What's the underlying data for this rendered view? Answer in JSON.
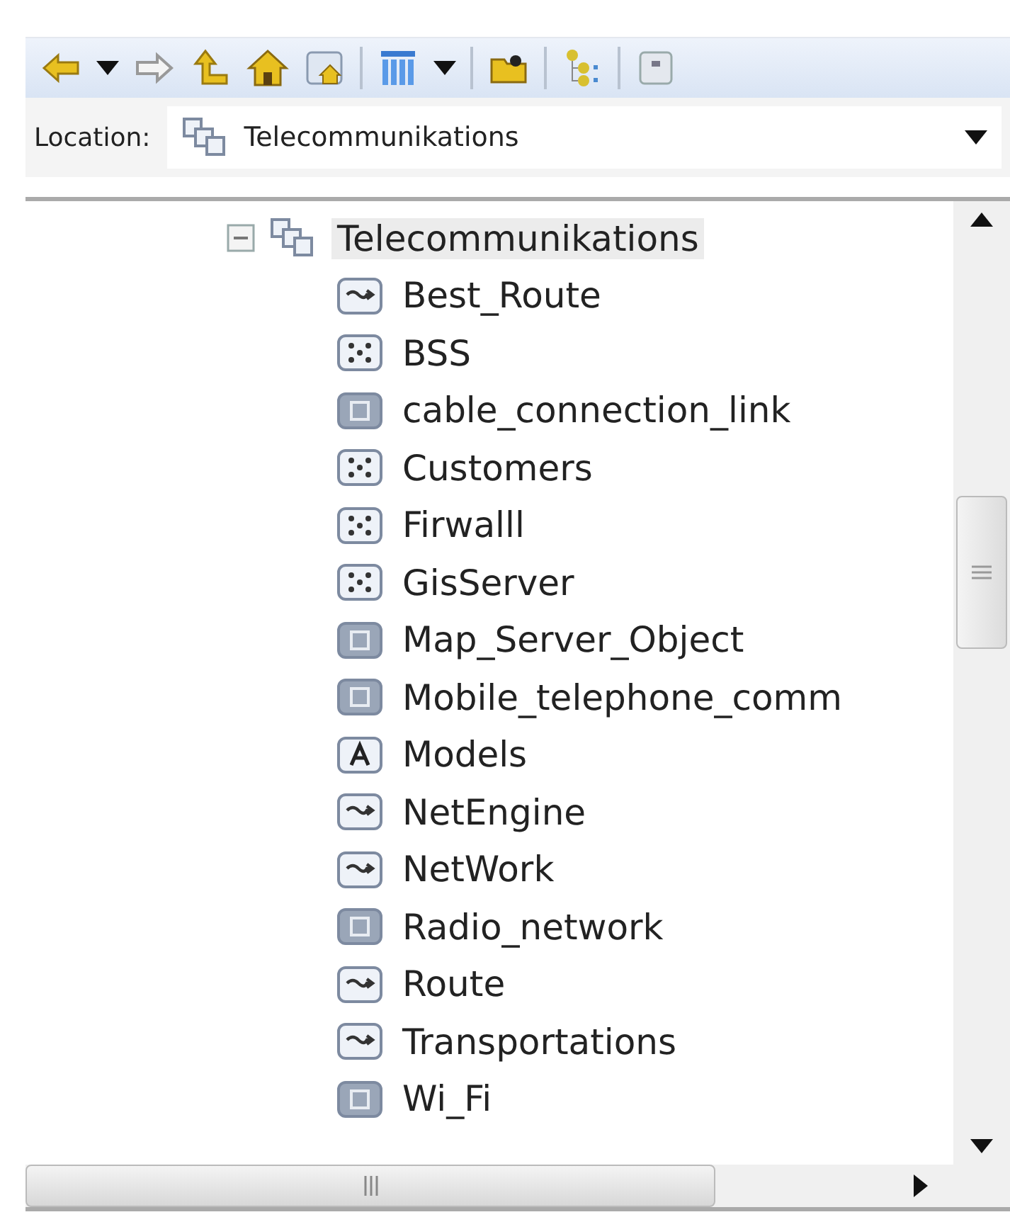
{
  "location": {
    "label": "Location:",
    "value": "Telecommunikations"
  },
  "tree": {
    "label": "Telecommunikations",
    "expanded": true,
    "selected": true,
    "children": [
      {
        "label": "Best_Route",
        "kind": "route",
        "selected": false
      },
      {
        "label": "BSS",
        "kind": "dots",
        "selected": false
      },
      {
        "label": "cable_connection_link",
        "kind": "object",
        "selected": false
      },
      {
        "label": "Customers",
        "kind": "dots",
        "selected": false
      },
      {
        "label": "Firwalll",
        "kind": "dots",
        "selected": false
      },
      {
        "label": "GisServer",
        "kind": "dots",
        "selected": false
      },
      {
        "label": "Map_Server_Object",
        "kind": "object",
        "selected": false
      },
      {
        "label": "Mobile_telephone_comm",
        "kind": "object",
        "selected": false
      },
      {
        "label": "Models",
        "kind": "abstract",
        "selected": false
      },
      {
        "label": "NetEngine",
        "kind": "route",
        "selected": false
      },
      {
        "label": "NetWork",
        "kind": "route",
        "selected": false
      },
      {
        "label": "Radio_network",
        "kind": "object",
        "selected": false
      },
      {
        "label": "Route",
        "kind": "route",
        "selected": false
      },
      {
        "label": "Transportations",
        "kind": "route",
        "selected": false
      },
      {
        "label": "Wi_Fi",
        "kind": "object",
        "selected": false
      }
    ]
  }
}
